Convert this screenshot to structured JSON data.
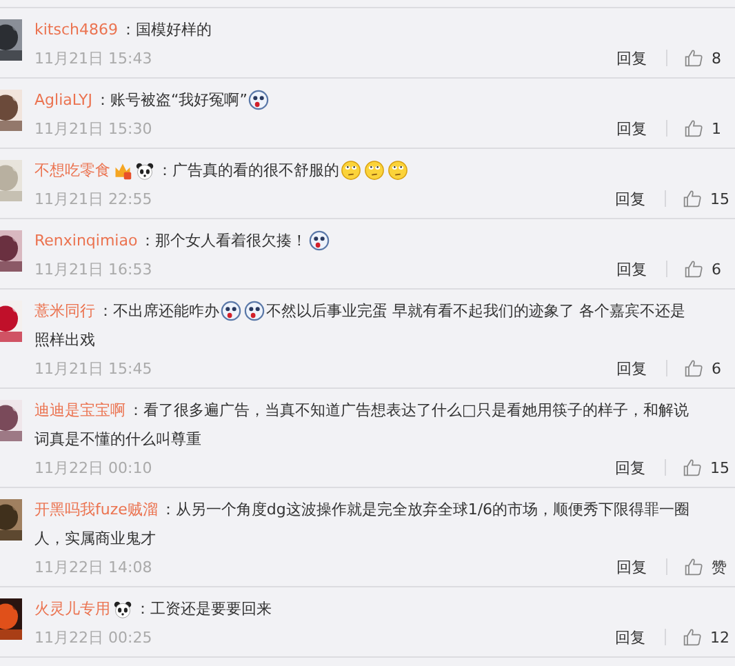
{
  "comments": [
    {
      "avatar": {
        "kind": "picture"
      },
      "user": "kitsch4869",
      "lines": [
        [
          {
            "kind": "text",
            "text": "：国模好样的"
          }
        ]
      ],
      "time": "11月21日 15:43",
      "reply": "回复",
      "likes": "8"
    },
    {
      "avatar": {
        "kind": "picture"
      },
      "user": "AgliaLYJ",
      "lines": [
        [
          {
            "kind": "text",
            "text": "：账号被盗“我好冤啊”"
          },
          {
            "kind": "sticker"
          }
        ]
      ],
      "time": "11月21日 15:30",
      "reply": "回复",
      "likes": "1"
    },
    {
      "avatar": {
        "kind": "picture"
      },
      "user": "不想吃零食",
      "badges": [
        {
          "kind": "crown"
        },
        {
          "kind": "panda"
        }
      ],
      "lines": [
        [
          {
            "kind": "text",
            "text": "：广告真的看的很不舒服的"
          },
          {
            "kind": "smiley"
          },
          {
            "kind": "smiley"
          },
          {
            "kind": "smiley"
          }
        ]
      ],
      "time": "11月21日 22:55",
      "reply": "回复",
      "likes": "15"
    },
    {
      "avatar": {
        "kind": "picture"
      },
      "user": "Renxinqimiao",
      "lines": [
        [
          {
            "kind": "text",
            "text": "：那个女人看着很欠揍！"
          },
          {
            "kind": "sticker"
          }
        ]
      ],
      "time": "11月21日 16:53",
      "reply": "回复",
      "likes": "6"
    },
    {
      "avatar": {
        "kind": "picture"
      },
      "user": "薏米同行",
      "lines": [
        [
          {
            "kind": "text",
            "text": "：不出席还能咋办"
          },
          {
            "kind": "sticker"
          },
          {
            "kind": "sticker"
          },
          {
            "kind": "text",
            "text": " 不然以后事业完蛋 早就有看不起我们的迹象了 各个嘉宾不还是"
          }
        ],
        [
          {
            "kind": "text",
            "text": "照样出戏"
          }
        ]
      ],
      "time": "11月21日 15:45",
      "reply": "回复",
      "likes": "6"
    },
    {
      "avatar": {
        "kind": "picture"
      },
      "user": "迪迪是宝宝啊",
      "lines": [
        [
          {
            "kind": "text",
            "text": "：看了很多遍广告，当真不知道广告想表达了什么□只是看她用筷子的样子，和解说"
          }
        ],
        [
          {
            "kind": "text",
            "text": "词真是不懂的什么叫尊重"
          }
        ]
      ],
      "time": "11月22日 00:10",
      "reply": "回复",
      "likes": "15"
    },
    {
      "avatar": {
        "kind": "picture"
      },
      "user": "开黑吗我fuze贼溜",
      "lines": [
        [
          {
            "kind": "text",
            "text": "：从另一个角度dg这波操作就是完全放弃全球1/6的市场，顺便秀下限得罪一圈"
          }
        ],
        [
          {
            "kind": "text",
            "text": "人，实属商业鬼才"
          }
        ]
      ],
      "time": "11月22日 14:08",
      "reply": "回复",
      "likes": "赞"
    },
    {
      "avatar": {
        "kind": "picture"
      },
      "user": "火灵儿专用",
      "badges": [
        {
          "kind": "panda"
        }
      ],
      "lines": [
        [
          {
            "kind": "text",
            "text": "：工资还是要要回来"
          }
        ]
      ],
      "time": "11月22日 00:25",
      "reply": "回复",
      "likes": "12"
    }
  ]
}
